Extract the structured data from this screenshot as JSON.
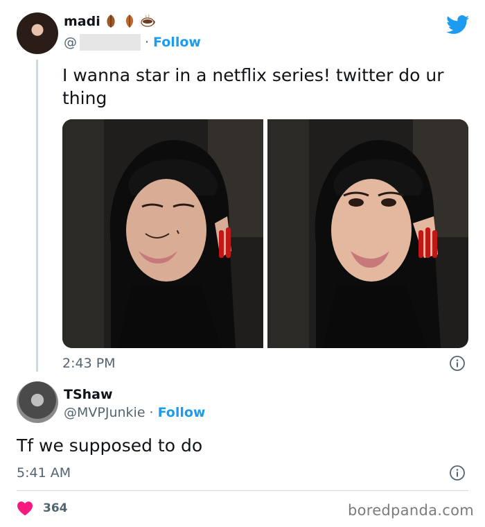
{
  "tweet": {
    "author": {
      "name": "madi",
      "handle_prefix": "@",
      "follow_label": "Follow"
    },
    "text": "I wanna star in a netflix series! twitter do ur thing",
    "time": "2:43 PM",
    "media_count": 2
  },
  "reply": {
    "author": {
      "name": "TShaw",
      "handle": "@MVPJunkie",
      "follow_label": "Follow"
    },
    "text": "Tf we supposed to do",
    "time": "5:41 AM"
  },
  "likes": {
    "count": "364"
  },
  "watermark": "boredpanda.com",
  "colors": {
    "accent": "#1d9bf0",
    "like": "#f91880",
    "secondary_text": "#536471"
  },
  "icons": {
    "brand": "twitter-bird-icon",
    "info": "info-circle-icon",
    "like": "heart-icon"
  }
}
